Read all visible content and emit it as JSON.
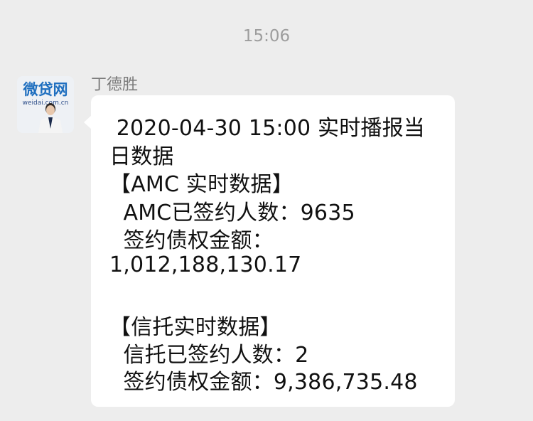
{
  "chat": {
    "timestamp": "15:06",
    "sender_name": "丁德胜",
    "avatar": {
      "logo_text": "微贷网",
      "domain_text": "weidai.com.cn"
    },
    "message": {
      "lines": [
        " 2020-04-30 15:00 实时播报当",
        "日数据",
        "【AMC 实时数据】",
        "  AMC已签约人数：9635",
        "  签约债权金额：",
        "1,012,188,130.17",
        "",
        "【信托实时数据】",
        "  信托已签约人数：2",
        "  签约债权金额：9,386,735.48"
      ]
    }
  },
  "colors": {
    "background": "#ededed",
    "bubble": "#ffffff",
    "text": "#111111",
    "meta_text": "#9d9d9d"
  }
}
